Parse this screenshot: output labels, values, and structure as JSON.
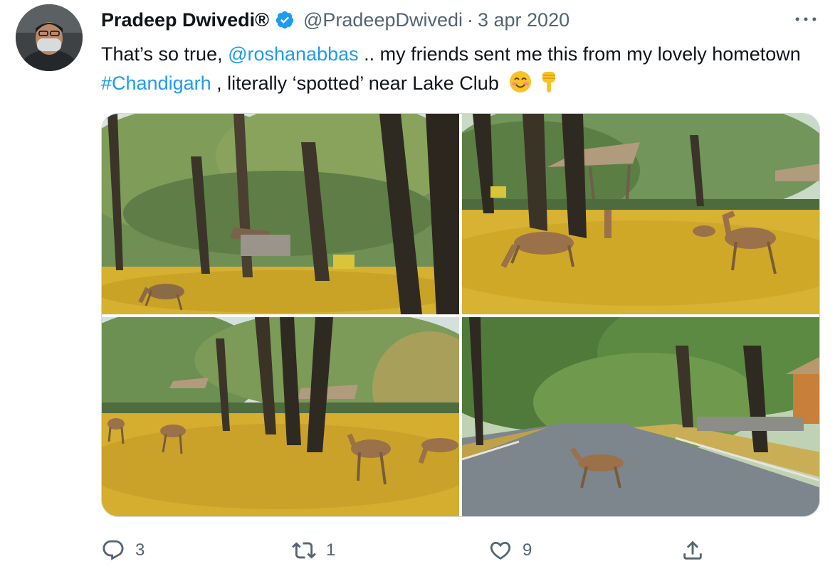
{
  "author": {
    "name": "Pradeep Dwivedi®",
    "handle": "@PradeepDwivedi",
    "separator": "·",
    "date": "3 apr 2020"
  },
  "tweet": {
    "text_1": "That’s so true, ",
    "mention": "@roshanabbas",
    "text_2": " .. my friends sent me this from my lovely hometown ",
    "hashtag": "#Chandigarh",
    "text_3": " , literally ‘spotted’ near Lake Club"
  },
  "icons": {
    "verified": "verified-badge-icon",
    "more": "more-dots-icon",
    "reply": "reply-icon",
    "retweet": "retweet-icon",
    "like": "like-icon",
    "share": "share-icon",
    "emoji_1": "smiling-face-emoji",
    "emoji_2": "pointing-down-emoji"
  },
  "metrics": {
    "replies": "3",
    "retweets": "1",
    "likes": "9"
  },
  "colors": {
    "link": "#1d9bf0",
    "muted": "#536471",
    "text": "#0f1419",
    "ground": "#d9b233"
  }
}
